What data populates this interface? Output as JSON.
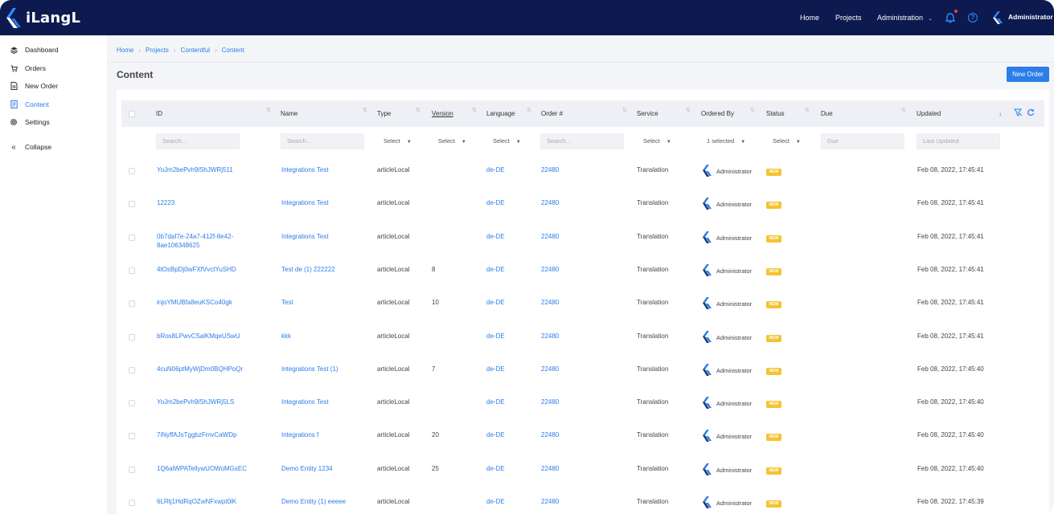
{
  "app": {
    "logo_text": "iLangL"
  },
  "topnav": {
    "home": "Home",
    "projects": "Projects",
    "administration": "Administration",
    "user": "Administrator"
  },
  "sidebar": {
    "items": [
      {
        "label": "Dashboard",
        "icon": "layers-icon"
      },
      {
        "label": "Orders",
        "icon": "cart-icon"
      },
      {
        "label": "New Order",
        "icon": "document-icon"
      },
      {
        "label": "Content",
        "icon": "content-icon"
      },
      {
        "label": "Settings",
        "icon": "gear-icon"
      },
      {
        "label": "Collapse",
        "icon": "double-chevron-left-icon"
      }
    ]
  },
  "breadcrumb": [
    "Home",
    "Projects",
    "Contentful",
    "Content"
  ],
  "page": {
    "title": "Content",
    "new_order_label": "New Order"
  },
  "table": {
    "headers": {
      "id": "ID",
      "name": "Name",
      "type": "Type",
      "version": "Version",
      "language": "Language",
      "order": "Order #",
      "service": "Service",
      "ordered_by": "Ordered By",
      "status": "Status",
      "due": "Due",
      "updated": "Updated"
    },
    "filters": {
      "id": "Search...",
      "name": "Search...",
      "type": "Select",
      "version": "Select",
      "language": "Select",
      "order": "Search...",
      "service": "Select",
      "ordered_by": "1 selected",
      "status": "Select",
      "due": "Due",
      "updated": "Last Updated"
    },
    "rows": [
      {
        "id": "YoJm2bePvh9lShJWRj511",
        "id2": "",
        "name": "Integrations Test",
        "type": "articleLocal",
        "version": "",
        "language": "de-DE",
        "order": "22480",
        "service": "Translation",
        "ordered_by": "Administrator",
        "status": "NEW",
        "updated": "Feb 08, 2022, 17:45:41"
      },
      {
        "id": "12223",
        "id2": "",
        "name": "Integrations Test",
        "type": "articleLocal",
        "version": "",
        "language": "de-DE",
        "order": "22480",
        "service": "Translation",
        "ordered_by": "Administrator",
        "status": "NEW",
        "updated": "Feb 08, 2022, 17:45:41"
      },
      {
        "id": "0b7daf7e-24a7-412f-8e42-",
        "id2": "8ae106348625",
        "name": "Integrations Test",
        "type": "articleLocal",
        "version": "",
        "language": "de-DE",
        "order": "22480",
        "service": "Translation",
        "ordered_by": "Administrator",
        "status": "NEW",
        "updated": "Feb 08, 2022, 17:45:41"
      },
      {
        "id": "4tOsBpDj0wFXfVvctYuSHD",
        "id2": "",
        "name": "Test de (1) 222222",
        "type": "articleLocal",
        "version": "8",
        "language": "de-DE",
        "order": "22480",
        "service": "Translation",
        "ordered_by": "Administrator",
        "status": "NEW",
        "updated": "Feb 08, 2022, 17:45:41"
      },
      {
        "id": "injoYMUBfa8euKSCo40gk",
        "id2": "",
        "name": "Test",
        "type": "articleLocal",
        "version": "10",
        "language": "de-DE",
        "order": "22480",
        "service": "Translation",
        "ordered_by": "Administrator",
        "status": "NEW",
        "updated": "Feb 08, 2022, 17:45:41"
      },
      {
        "id": "bRos8LPwvCSalKMqeUSwU",
        "id2": "",
        "name": "kkk",
        "type": "articleLocal",
        "version": "",
        "language": "de-DE",
        "order": "22480",
        "service": "Translation",
        "ordered_by": "Administrator",
        "status": "NEW",
        "updated": "Feb 08, 2022, 17:45:41"
      },
      {
        "id": "4cuN06ptMyWjDm0BQHPoQr",
        "id2": "",
        "name": "Integrations Test (1)",
        "type": "articleLocal",
        "version": "7",
        "language": "de-DE",
        "order": "22480",
        "service": "Translation",
        "ordered_by": "Administrator",
        "status": "NEW",
        "updated": "Feb 08, 2022, 17:45:40"
      },
      {
        "id": "YoJm2bePvh9lShJWRj5LS",
        "id2": "",
        "name": "Integrations Test",
        "type": "articleLocal",
        "version": "",
        "language": "de-DE",
        "order": "22480",
        "service": "Translation",
        "ordered_by": "Administrator",
        "status": "NEW",
        "updated": "Feb 08, 2022, 17:45:40"
      },
      {
        "id": "7iNyffAJsTggbzFmvCaWDp",
        "id2": "",
        "name": "Integrations f",
        "type": "articleLocal",
        "version": "20",
        "language": "de-DE",
        "order": "22480",
        "service": "Translation",
        "ordered_by": "Administrator",
        "status": "NEW",
        "updated": "Feb 08, 2022, 17:45:40"
      },
      {
        "id": "1Q6alWPATellywUOWoMGsEC",
        "id2": "",
        "name": "Demo Entity 1234",
        "type": "articleLocal",
        "version": "25",
        "language": "de-DE",
        "order": "22480",
        "service": "Translation",
        "ordered_by": "Administrator",
        "status": "NEW",
        "updated": "Feb 08, 2022, 17:45:40"
      },
      {
        "id": "6LRtj1HdRqOZwNFxwpt0iK",
        "id2": "",
        "name": "Demo Entity (1) eeeee",
        "type": "articleLocal",
        "version": "",
        "language": "de-DE",
        "order": "22480",
        "service": "Translation",
        "ordered_by": "Administrator",
        "status": "NEW",
        "updated": "Feb 08, 2022, 17:45:39"
      }
    ]
  },
  "colors": {
    "header_bg": "#0c1a4f",
    "accent": "#2b7de9",
    "badge_new": "#f4c430"
  }
}
